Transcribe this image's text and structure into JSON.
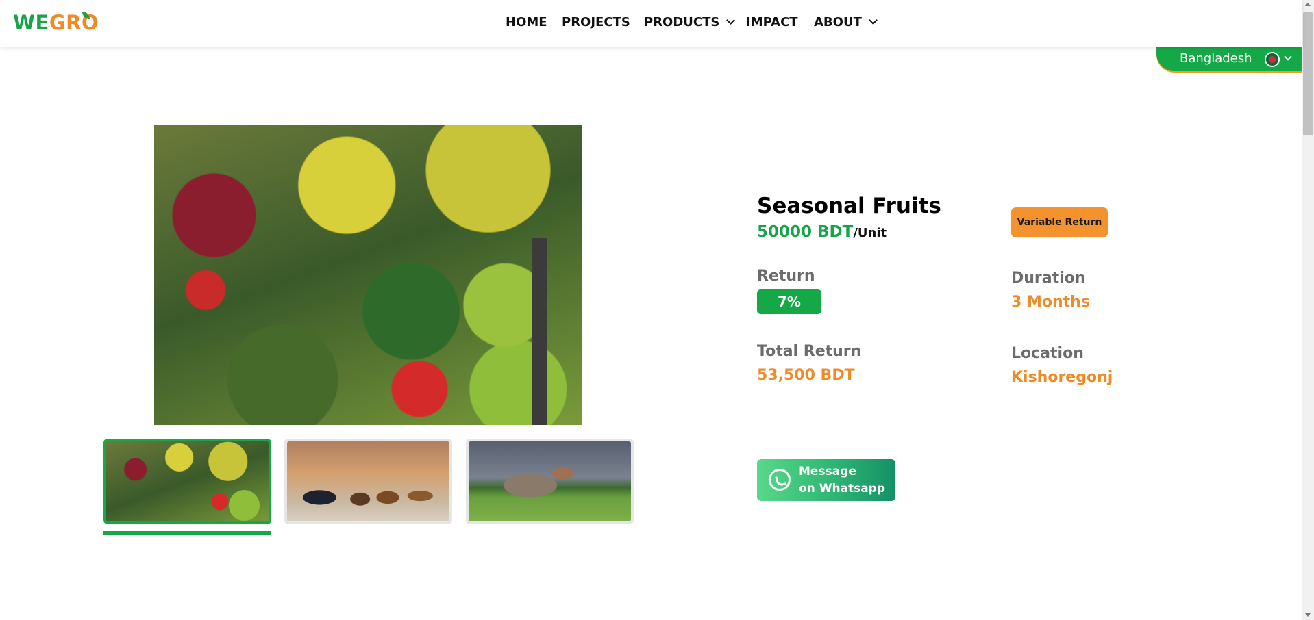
{
  "brand": {
    "logo_we": "WE",
    "logo_gro": "GRO"
  },
  "nav": {
    "items": [
      {
        "label": "HOME",
        "has_dropdown": false
      },
      {
        "label": "PROJECTS",
        "has_dropdown": false
      },
      {
        "label": "PRODUCTS",
        "has_dropdown": true
      },
      {
        "label": "IMPACT",
        "has_dropdown": false
      },
      {
        "label": "ABOUT",
        "has_dropdown": true
      }
    ]
  },
  "country_selector": {
    "label": "Bangladesh",
    "flag_icon": "bangladesh-flag-icon"
  },
  "gallery": {
    "main_image": "seasonal-fruits-market-image",
    "thumbnails": [
      {
        "name": "fruits-thumbnail",
        "active": true
      },
      {
        "name": "chickens-barn-thumbnail",
        "active": false
      },
      {
        "name": "rooster-field-thumbnail",
        "active": false
      }
    ]
  },
  "product": {
    "title": "Seasonal Fruits",
    "price_value": "50000 BDT",
    "price_unit": "/Unit",
    "return_type_badge": "Variable Return",
    "return_label": "Return",
    "return_value": "7%",
    "duration_label": "Duration",
    "duration_value": "3 Months",
    "total_return_label": "Total Return",
    "total_return_value": "53,500 BDT",
    "location_label": "Location",
    "location_value": "Kishoregonj"
  },
  "whatsapp": {
    "line1": "Message",
    "line2": "on Whatsapp",
    "icon": "whatsapp-icon"
  },
  "colors": {
    "brand_green": "#14a847",
    "accent_orange": "#f08a24"
  }
}
